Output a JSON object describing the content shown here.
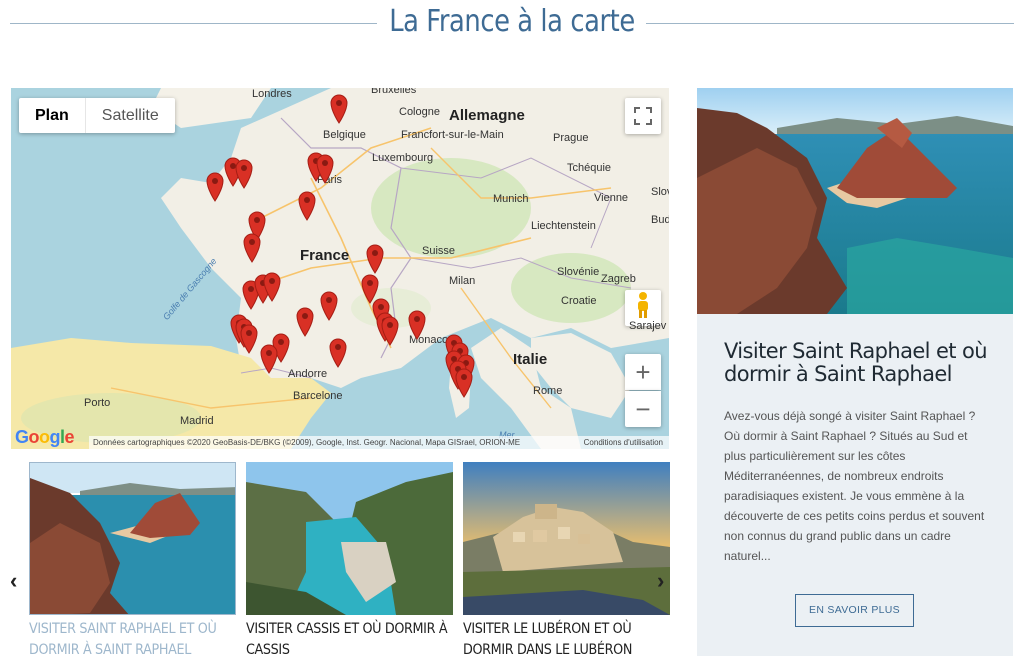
{
  "heading": {
    "title": "La France à la carte"
  },
  "map": {
    "type_buttons": {
      "plan": "Plan",
      "satellite": "Satellite"
    },
    "labels": {
      "londres": "Londres",
      "bruxelles": "Bruxelles",
      "cologne": "Cologne",
      "allemagne": "Allemagne",
      "belgique": "Belgique",
      "francfort": "Francfort-sur-le-Main",
      "prague": "Prague",
      "luxembourg": "Luxembourg",
      "tcheque": "Tchéquie",
      "paris": "Paris",
      "munich": "Munich",
      "vienne": "Vienne",
      "france": "France",
      "suisse": "Suisse",
      "liechtenstein": "Liechtenstein",
      "zagreb": "Zagreb",
      "slovenie": "Slovénie",
      "milan": "Milan",
      "croatie": "Croatie",
      "sarajevo": "Sarajev",
      "monaco": "Monaco",
      "italie": "Italie",
      "andorre": "Andorre",
      "barcelone": "Barcelone",
      "rome": "Rome",
      "porto": "Porto",
      "madrid": "Madrid",
      "golfe": "Golfe de Gascogne",
      "budapest": "Buda",
      "slov": "Slov",
      "mer": "Mer"
    },
    "google_logo": [
      "G",
      "o",
      "o",
      "g",
      "l",
      "e"
    ],
    "attribution": "Données cartographiques ©2020 GeoBasis-DE/BKG (©2009), Google, Inst. Geogr. Nacional, Mapa GISrael, ORION-ME",
    "terms": "Conditions d'utilisation",
    "zoom_in": "+",
    "zoom_out": "−",
    "marker_color": "#d93025"
  },
  "feature": {
    "title": "Visiter Saint Raphael et où dormir à Saint Raphael",
    "description": "Avez-vous déjà songé à visiter Saint Raphael ? Où dormir à Saint Raphael ? Situés au Sud et plus particulièrement sur les côtes Méditerranéennes, de nombreux endroits paradisiaques existent. Je vous emmène à la découverte de ces petits coins perdus et souvent non connus du grand public dans un cadre naturel...",
    "button": "EN SAVOIR PLUS"
  },
  "carousel": {
    "prev": "‹",
    "next": "›",
    "cards": [
      {
        "title": "Visiter Saint Raphael et où dormir à Saint Raphael"
      },
      {
        "title": "Visiter Cassis et où dormir à Cassis"
      },
      {
        "title": "Visiter le Lubéron et où dormir dans le Lubéron"
      }
    ]
  },
  "colors": {
    "accent": "#3e6b94",
    "active_card": "#9eb7cc",
    "card_bg": "#ebf0f4"
  }
}
